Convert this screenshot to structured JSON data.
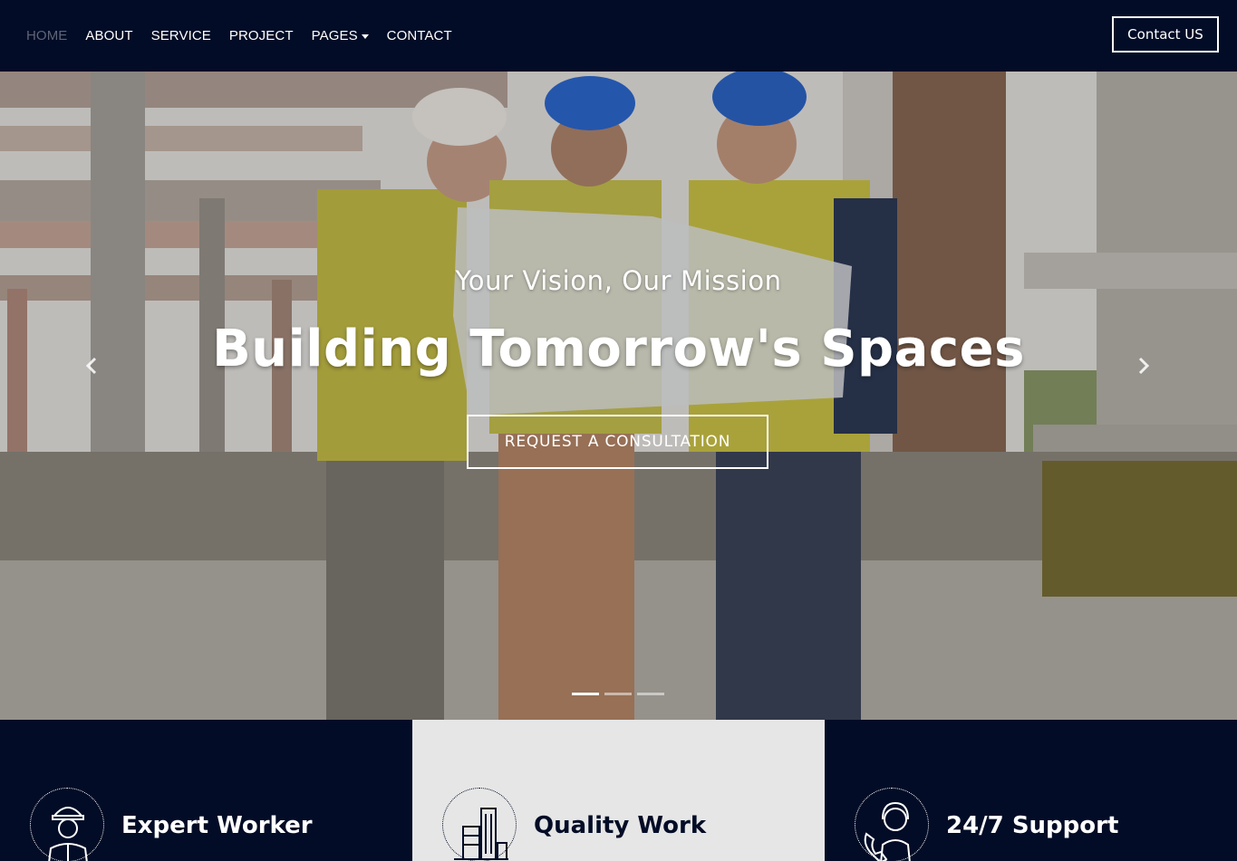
{
  "nav": {
    "links": [
      {
        "label": "HOME"
      },
      {
        "label": "ABOUT"
      },
      {
        "label": "SERVICE"
      },
      {
        "label": "PROJECT"
      },
      {
        "label": "PAGES"
      },
      {
        "label": "CONTACT"
      }
    ],
    "contact_button": "Contact US"
  },
  "hero": {
    "subtitle": "Your Vision, Our Mission",
    "title": "Building Tomorrow's Spaces",
    "button": "REQUEST A CONSULTATION",
    "prev_icon": "chevron-left-icon",
    "next_icon": "chevron-right-icon",
    "slides_total": 3,
    "active_slide": 1
  },
  "features": [
    {
      "title": "Expert Worker",
      "icon": "worker-icon"
    },
    {
      "title": "Quality Work",
      "icon": "buildings-icon"
    },
    {
      "title": "24/7 Support",
      "icon": "support-icon"
    }
  ],
  "colors": {
    "navy": "#020c26",
    "light_panel": "#e6e6e6",
    "white": "#ffffff"
  }
}
